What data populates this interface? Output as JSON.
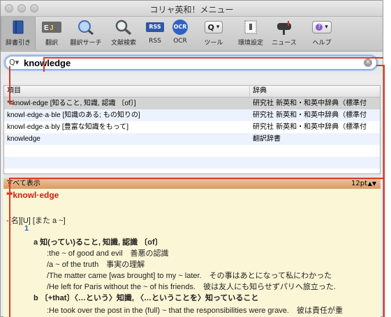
{
  "window": {
    "title": "コリャ英和！メニュー"
  },
  "toolbar": {
    "items": [
      {
        "label": "辞書引き",
        "icon": "book-icon"
      },
      {
        "label": "翻訳",
        "icon": "translate-icon"
      },
      {
        "label": "翻訳サーチ",
        "icon": "globe-search-icon"
      },
      {
        "label": "文献検索",
        "icon": "magnifier-icon"
      },
      {
        "label": "RSS",
        "icon": "rss-icon",
        "badge": "RSS"
      },
      {
        "label": "OCR",
        "icon": "ocr-icon",
        "badge": "OCR"
      },
      {
        "label": "ツール",
        "icon": "tool-dropdown-icon"
      },
      {
        "label": "環境設定",
        "icon": "settings-icon"
      },
      {
        "label": "ニュース",
        "icon": "mailbox-icon"
      },
      {
        "label": "ヘルプ",
        "icon": "help-dropdown-icon"
      }
    ]
  },
  "search": {
    "value": "knowledge",
    "placeholder": ""
  },
  "table": {
    "headers": [
      "項目",
      "辞典"
    ],
    "rows": [
      {
        "entry": "**knowl·edge  [知ること, 知識, 認識 〔of〕]",
        "dict": "研究社 新英和・和英中辞典（標準付"
      },
      {
        "entry": "knowl·edge·a·ble  [知識のある; もの知りの]",
        "dict": "研究社 新英和・和英中辞典（標準付"
      },
      {
        "entry": "knowl·edge·a·bly  [豊富な知識をもって]",
        "dict": "研究社 新英和・和英中辞典（標準付"
      },
      {
        "entry": "knowledge",
        "dict": "翻訳辞書"
      }
    ]
  },
  "detail": {
    "show_all": "すべて表示",
    "font_size": "12pt",
    "headword": "**knowl·edge",
    "pos": "-[名][U] [また a ~]",
    "sense_num": "1",
    "sense_a": "a 知(ってい)ること, 知識, 認識 〔of〕",
    "ex1": ":the ~ of good and evil　善悪の認識",
    "ex2": "/a ~ of the truth　事実の理解",
    "ex3": "/The matter came [was brought] to my ~ later.　その事はあとになって私にわかった",
    "ex4": "/He left for Paris without the ~ of his friends.　彼は友人にも知らせずパリへ旅立った.",
    "sense_b": "b 〔+that〕〈…という〉知識, 〈…ということを〉知っていること",
    "ex5": ":He took over the post in the (full) ~ that the responsibilities were grave.　彼は責任が重"
  }
}
